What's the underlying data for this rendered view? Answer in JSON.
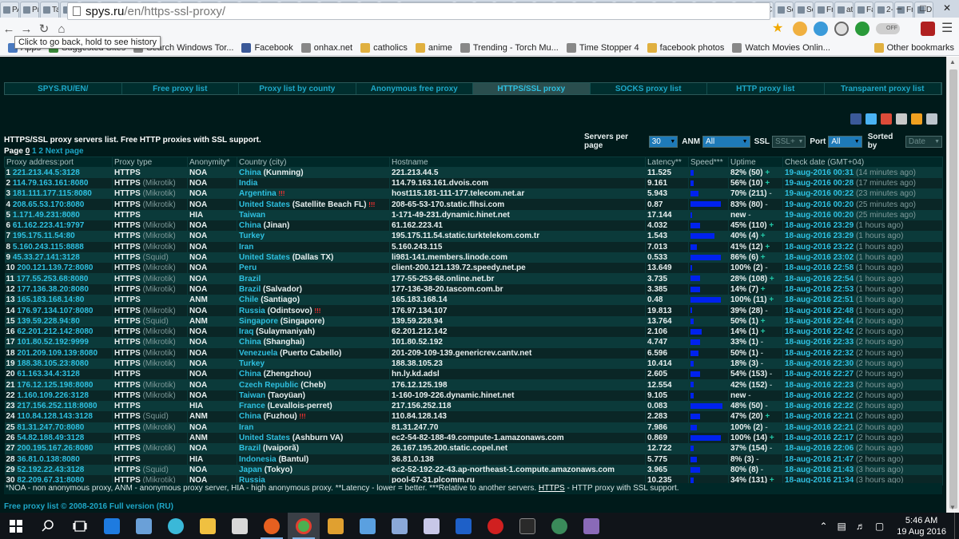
{
  "browser": {
    "tabs": [
      "PA",
      "Pr",
      "Ta",
      "H",
      "Tr",
      "Fr",
      "Bl",
      "(1",
      "Fr",
      "(2",
      "H",
      "fre",
      "U",
      "Fa",
      "Fr",
      "X-",
      "Ke",
      "N",
      "Ta",
      "Di",
      "spys.ru",
      "Gl",
      "Gl",
      "G",
      "Ta",
      "Sn",
      "Tu",
      "VF",
      "H",
      "U",
      "VF",
      "Ol",
      "VF",
      "N",
      "Fr",
      "Cr",
      "Cr",
      "Sc",
      "Sc",
      "Fr",
      "at",
      "Fa",
      "2-",
      "Fr",
      "D"
    ],
    "active_tab_index": 20,
    "url_host": "spys.ru",
    "url_path": "/en/https-ssl-proxy/",
    "tooltip": "Click to go back, hold to see history",
    "toggle_label": "OFF",
    "bookmarks": [
      {
        "label": "Apps",
        "icon": "apps-icon",
        "color": "#4a7ac0"
      },
      {
        "label": "Suggested Sites",
        "icon": "suggested-icon",
        "color": "#3a8a3a"
      },
      {
        "label": "Search Windows Tor...",
        "icon": "page-icon",
        "color": "#888888"
      },
      {
        "label": "Facebook",
        "icon": "facebook-icon",
        "color": "#3b5998"
      },
      {
        "label": "onhax.net",
        "icon": "page-icon",
        "color": "#888888"
      },
      {
        "label": "catholics",
        "icon": "folder-icon",
        "color": "#e0b040"
      },
      {
        "label": "anime",
        "icon": "folder-icon",
        "color": "#e0b040"
      },
      {
        "label": "Trending - Torch Mu...",
        "icon": "page-icon",
        "color": "#888888"
      },
      {
        "label": "Time Stopper 4",
        "icon": "page-icon",
        "color": "#888888"
      },
      {
        "label": "facebook photos",
        "icon": "folder-icon",
        "color": "#e0b040"
      },
      {
        "label": "Watch Movies Onlin...",
        "icon": "page-icon",
        "color": "#888888"
      }
    ],
    "bookmarks_more": "»",
    "other_bookmarks": "Other bookmarks"
  },
  "site": {
    "nav": [
      "SPYS.RU/EN/",
      "Free proxy list",
      "Proxy list by county",
      "Anonymous free proxy",
      "HTTPS/SSL proxy",
      "SOCKS proxy list",
      "HTTP proxy list",
      "Transparent proxy list"
    ],
    "nav_current_index": 4,
    "list_title": "HTTPS/SSL proxy servers list. Free HTTP proxies with SSL support.",
    "controls": {
      "servers_per_page_label": "Servers per page",
      "servers_per_page_value": "30",
      "anm_label": "ANM",
      "anm_value": "All",
      "ssl_label": "SSL",
      "ssl_value": "SSL+",
      "port_label": "Port",
      "port_value": "All",
      "sorted_label": "Sorted by",
      "sorted_value": "Date"
    },
    "pager": {
      "label": "Page",
      "current": "0",
      "pages": [
        "1",
        "2"
      ],
      "next": "Next page"
    },
    "columns": [
      "Proxy address:port",
      "Proxy type",
      "Anonymity*",
      "Country (city)",
      "Hostname",
      "Latency**",
      "Speed***",
      "Uptime",
      "Check date (GMT+04)"
    ],
    "rows": [
      {
        "n": "1",
        "addr": "221.213.44.5:3128",
        "type": "HTTPS",
        "sub": "",
        "anon": "NOA",
        "country": "China",
        "city": "(Kunming)",
        "warn": "",
        "host": "221.213.44.5",
        "lat": "11.525",
        "speed": 0.1,
        "up": "82% (50)",
        "trend": "+",
        "date": "19-aug-2016 00:31",
        "ago": "(14 minutes ago)"
      },
      {
        "n": "2",
        "addr": "114.79.163.161:8080",
        "type": "HTTPS",
        "sub": "(Mikrotik)",
        "anon": "NOA",
        "country": "India",
        "city": "",
        "warn": "",
        "host": "114.79.163.161.dvois.com",
        "lat": "9.161",
        "speed": 0.1,
        "up": "56% (10)",
        "trend": "+",
        "date": "19-aug-2016 00:28",
        "ago": "(17 minutes ago)"
      },
      {
        "n": "3",
        "addr": "181.111.177.115:8080",
        "type": "HTTPS",
        "sub": "(Mikrotik)",
        "anon": "NOA",
        "country": "Argentina",
        "city": "",
        "warn": "!!!",
        "host": "host115.181-111-177.telecom.net.ar",
        "lat": "5.943",
        "speed": 0.25,
        "up": "70% (211)",
        "trend": "-",
        "date": "19-aug-2016 00:22",
        "ago": "(23 minutes ago)"
      },
      {
        "n": "4",
        "addr": "208.65.53.170:8080",
        "type": "HTTPS",
        "sub": "(Mikrotik)",
        "anon": "NOA",
        "country": "United States",
        "city": "(Satellite Beach FL)",
        "warn": "!!!",
        "host": "208-65-53-170.static.flhsi.com",
        "lat": "0.87",
        "speed": 0.95,
        "up": "83% (80)",
        "trend": "-",
        "date": "19-aug-2016 00:20",
        "ago": "(25 minutes ago)"
      },
      {
        "n": "5",
        "addr": "1.171.49.231:8080",
        "type": "HTTPS",
        "sub": "",
        "anon": "HIA",
        "country": "Taiwan",
        "city": "",
        "warn": "",
        "host": "1-171-49-231.dynamic.hinet.net",
        "lat": "17.144",
        "speed": 0.02,
        "up": "new",
        "trend": "-",
        "date": "19-aug-2016 00:20",
        "ago": "(25 minutes ago)"
      },
      {
        "n": "6",
        "addr": "61.162.223.41:9797",
        "type": "HTTPS",
        "sub": "(Mikrotik)",
        "anon": "NOA",
        "country": "China",
        "city": "(Jinan)",
        "warn": "",
        "host": "61.162.223.41",
        "lat": "4.032",
        "speed": 0.3,
        "up": "45% (110)",
        "trend": "+",
        "date": "18-aug-2016 23:29",
        "ago": "(1 hours ago)"
      },
      {
        "n": "7",
        "addr": "195.175.11.54:80",
        "type": "HTTPS",
        "sub": "(Mikrotik)",
        "anon": "NOA",
        "country": "Turkey",
        "city": "",
        "warn": "",
        "host": "195.175.11.54.static.turktelekom.com.tr",
        "lat": "1.543",
        "speed": 0.75,
        "up": "40% (4)",
        "trend": "+",
        "date": "18-aug-2016 23:29",
        "ago": "(1 hours ago)"
      },
      {
        "n": "8",
        "addr": "5.160.243.115:8888",
        "type": "HTTPS",
        "sub": "(Mikrotik)",
        "anon": "NOA",
        "country": "Iran",
        "city": "",
        "warn": "",
        "host": "5.160.243.115",
        "lat": "7.013",
        "speed": 0.2,
        "up": "41% (12)",
        "trend": "+",
        "date": "18-aug-2016 23:22",
        "ago": "(1 hours ago)"
      },
      {
        "n": "9",
        "addr": "45.33.27.141:3128",
        "type": "HTTPS",
        "sub": "(Squid)",
        "anon": "NOA",
        "country": "United States",
        "city": "(Dallas TX)",
        "warn": "",
        "host": "li981-141.members.linode.com",
        "lat": "0.533",
        "speed": 0.95,
        "up": "86% (6)",
        "trend": "+",
        "date": "18-aug-2016 23:02",
        "ago": "(1 hours ago)"
      },
      {
        "n": "10",
        "addr": "200.121.139.72:8080",
        "type": "HTTPS",
        "sub": "(Mikrotik)",
        "anon": "NOA",
        "country": "Peru",
        "city": "",
        "warn": "",
        "host": "client-200.121.139.72.speedy.net.pe",
        "lat": "13.649",
        "speed": 0.05,
        "up": "100% (2)",
        "trend": "-",
        "date": "18-aug-2016 22:58",
        "ago": "(1 hours ago)"
      },
      {
        "n": "11",
        "addr": "177.55.253.68:8080",
        "type": "HTTPS",
        "sub": "(Mikrotik)",
        "anon": "NOA",
        "country": "Brazil",
        "city": "",
        "warn": "",
        "host": "177-55-253-68.online.net.br",
        "lat": "3.735",
        "speed": 0.3,
        "up": "28% (108)",
        "trend": "+",
        "date": "18-aug-2016 22:54",
        "ago": "(1 hours ago)"
      },
      {
        "n": "12",
        "addr": "177.136.38.20:8080",
        "type": "HTTPS",
        "sub": "(Mikrotik)",
        "anon": "NOA",
        "country": "Brazil",
        "city": "(Salvador)",
        "warn": "",
        "host": "177-136-38-20.tascom.com.br",
        "lat": "3.385",
        "speed": 0.3,
        "up": "14% (7)",
        "trend": "+",
        "date": "18-aug-2016 22:53",
        "ago": "(1 hours ago)"
      },
      {
        "n": "13",
        "addr": "165.183.168.14:80",
        "type": "HTTPS",
        "sub": "",
        "anon": "ANM",
        "country": "Chile",
        "city": "(Santiago)",
        "warn": "",
        "host": "165.183.168.14",
        "lat": "0.48",
        "speed": 0.95,
        "up": "100% (11)",
        "trend": "+",
        "date": "18-aug-2016 22:51",
        "ago": "(1 hours ago)"
      },
      {
        "n": "14",
        "addr": "176.97.134.107:8080",
        "type": "HTTPS",
        "sub": "(Mikrotik)",
        "anon": "NOA",
        "country": "Russia",
        "city": "(Odintsovo)",
        "warn": "!!!",
        "host": "176.97.134.107",
        "lat": "19.813",
        "speed": 0.03,
        "up": "39% (28)",
        "trend": "-",
        "date": "18-aug-2016 22:48",
        "ago": "(1 hours ago)"
      },
      {
        "n": "15",
        "addr": "139.59.228.94:80",
        "type": "HTTPS",
        "sub": "(Squid)",
        "anon": "ANM",
        "country": "Singapore",
        "city": "(Singapore)",
        "warn": "",
        "host": "139.59.228.94",
        "lat": "13.764",
        "speed": 0.1,
        "up": "50% (1)",
        "trend": "+",
        "date": "18-aug-2016 22:44",
        "ago": "(2 hours ago)"
      },
      {
        "n": "16",
        "addr": "62.201.212.142:8080",
        "type": "HTTPS",
        "sub": "(Mikrotik)",
        "anon": "NOA",
        "country": "Iraq",
        "city": "(Sulaymaniyah)",
        "warn": "",
        "host": "62.201.212.142",
        "lat": "2.106",
        "speed": 0.35,
        "up": "14% (1)",
        "trend": "+",
        "date": "18-aug-2016 22:42",
        "ago": "(2 hours ago)"
      },
      {
        "n": "17",
        "addr": "101.80.52.192:9999",
        "type": "HTTPS",
        "sub": "(Mikrotik)",
        "anon": "NOA",
        "country": "China",
        "city": "(Shanghai)",
        "warn": "",
        "host": "101.80.52.192",
        "lat": "4.747",
        "speed": 0.3,
        "up": "33% (1)",
        "trend": "-",
        "date": "18-aug-2016 22:33",
        "ago": "(2 hours ago)"
      },
      {
        "n": "18",
        "addr": "201.209.109.139:8080",
        "type": "HTTPS",
        "sub": "(Mikrotik)",
        "anon": "NOA",
        "country": "Venezuela",
        "city": "(Puerto Cabello)",
        "warn": "",
        "host": "201-209-109-139.genericrev.cantv.net",
        "lat": "6.596",
        "speed": 0.25,
        "up": "50% (1)",
        "trend": "-",
        "date": "18-aug-2016 22:32",
        "ago": "(2 hours ago)"
      },
      {
        "n": "19",
        "addr": "188.38.105.23:8080",
        "type": "HTTPS",
        "sub": "(Mikrotik)",
        "anon": "NOA",
        "country": "Turkey",
        "city": "",
        "warn": "",
        "host": "188.38.105.23",
        "lat": "10.414",
        "speed": 0.1,
        "up": "18% (3)",
        "trend": "-",
        "date": "18-aug-2016 22:30",
        "ago": "(2 hours ago)"
      },
      {
        "n": "20",
        "addr": "61.163.34.4:3128",
        "type": "HTTPS",
        "sub": "",
        "anon": "NOA",
        "country": "China",
        "city": "(Zhengzhou)",
        "warn": "",
        "host": "hn.ly.kd.adsl",
        "lat": "2.605",
        "speed": 0.3,
        "up": "54% (153)",
        "trend": "-",
        "date": "18-aug-2016 22:27",
        "ago": "(2 hours ago)"
      },
      {
        "n": "21",
        "addr": "176.12.125.198:8080",
        "type": "HTTPS",
        "sub": "(Mikrotik)",
        "anon": "NOA",
        "country": "Czech Republic",
        "city": "(Cheb)",
        "warn": "",
        "host": "176.12.125.198",
        "lat": "12.554",
        "speed": 0.1,
        "up": "42% (152)",
        "trend": "-",
        "date": "18-aug-2016 22:23",
        "ago": "(2 hours ago)"
      },
      {
        "n": "22",
        "addr": "1.160.109.226:3128",
        "type": "HTTPS",
        "sub": "(Mikrotik)",
        "anon": "NOA",
        "country": "Taiwan",
        "city": "(Taoyüan)",
        "warn": "",
        "host": "1-160-109-226.dynamic.hinet.net",
        "lat": "9.105",
        "speed": 0.1,
        "up": "new",
        "trend": "-",
        "date": "18-aug-2016 22:22",
        "ago": "(2 hours ago)"
      },
      {
        "n": "23",
        "addr": "217.156.252.118:8080",
        "type": "HTTPS",
        "sub": "",
        "anon": "HIA",
        "country": "France",
        "city": "(Levallois-perret)",
        "warn": "",
        "host": "217.156.252.118",
        "lat": "0.083",
        "speed": 1.0,
        "up": "48% (50)",
        "trend": "-",
        "date": "18-aug-2016 22:22",
        "ago": "(2 hours ago)"
      },
      {
        "n": "24",
        "addr": "110.84.128.143:3128",
        "type": "HTTPS",
        "sub": "(Squid)",
        "anon": "ANM",
        "country": "China",
        "city": "(Fuzhou)",
        "warn": "!!!",
        "host": "110.84.128.143",
        "lat": "2.283",
        "speed": 0.3,
        "up": "47% (20)",
        "trend": "+",
        "date": "18-aug-2016 22:21",
        "ago": "(2 hours ago)"
      },
      {
        "n": "25",
        "addr": "81.31.247.70:8080",
        "type": "HTTPS",
        "sub": "(Mikrotik)",
        "anon": "NOA",
        "country": "Iran",
        "city": "",
        "warn": "",
        "host": "81.31.247.70",
        "lat": "7.986",
        "speed": 0.2,
        "up": "100% (2)",
        "trend": "-",
        "date": "18-aug-2016 22:21",
        "ago": "(2 hours ago)"
      },
      {
        "n": "26",
        "addr": "54.82.188.49:3128",
        "type": "HTTPS",
        "sub": "",
        "anon": "ANM",
        "country": "United States",
        "city": "(Ashburn VA)",
        "warn": "",
        "host": "ec2-54-82-188-49.compute-1.amazonaws.com",
        "lat": "0.869",
        "speed": 0.95,
        "up": "100% (14)",
        "trend": "+",
        "date": "18-aug-2016 22:17",
        "ago": "(2 hours ago)"
      },
      {
        "n": "27",
        "addr": "200.195.167.26:8080",
        "type": "HTTPS",
        "sub": "(Mikrotik)",
        "anon": "NOA",
        "country": "Brazil",
        "city": "(Ivaiporã)",
        "warn": "",
        "host": "26.167.195.200.static.copel.net",
        "lat": "12.722",
        "speed": 0.1,
        "up": "37% (154)",
        "trend": "-",
        "date": "18-aug-2016 22:06",
        "ago": "(2 hours ago)"
      },
      {
        "n": "28",
        "addr": "36.81.0.138:8080",
        "type": "HTTPS",
        "sub": "",
        "anon": "HIA",
        "country": "Indonesia",
        "city": "(Bantul)",
        "warn": "",
        "host": "36.81.0.138",
        "lat": "5.775",
        "speed": 0.2,
        "up": "8% (3)",
        "trend": "-",
        "date": "18-aug-2016 21:47",
        "ago": "(2 hours ago)"
      },
      {
        "n": "29",
        "addr": "52.192.22.43:3128",
        "type": "HTTPS",
        "sub": "(Squid)",
        "anon": "NOA",
        "country": "Japan",
        "city": "(Tokyo)",
        "warn": "",
        "host": "ec2-52-192-22-43.ap-northeast-1.compute.amazonaws.com",
        "lat": "3.965",
        "speed": 0.3,
        "up": "80% (8)",
        "trend": "-",
        "date": "18-aug-2016 21:43",
        "ago": "(3 hours ago)"
      },
      {
        "n": "30",
        "addr": "82.209.67.31:8080",
        "type": "HTTPS",
        "sub": "(Mikrotik)",
        "anon": "NOA",
        "country": "Russia",
        "city": "",
        "warn": "",
        "host": "pool-67-31.plcomm.ru",
        "lat": "10.235",
        "speed": 0.1,
        "up": "34% (131)",
        "trend": "+",
        "date": "18-aug-2016 21:34",
        "ago": "(3 hours ago)"
      }
    ],
    "footnote_pre": "*NOA - non anonymous proxy, ANM - anonymous proxy server, HIA - high anonymous proxy. **Latency - lower = better. ***Relative to another servers.",
    "footnote_https": "HTTPS",
    "footnote_post": "- HTTP proxy with SSL support.",
    "copyright": "Free proxy list © 2008-2016",
    "full_version": "Full version (RU)"
  },
  "taskbar": {
    "time": "5:46 AM",
    "date": "19 Aug 2016"
  },
  "colors": {
    "page_bg": "#001a1a",
    "link": "#2ec0e0",
    "speed_bar": "#0022ee",
    "row_odd": "#0b3a3a",
    "row_even": "#0a2626"
  }
}
